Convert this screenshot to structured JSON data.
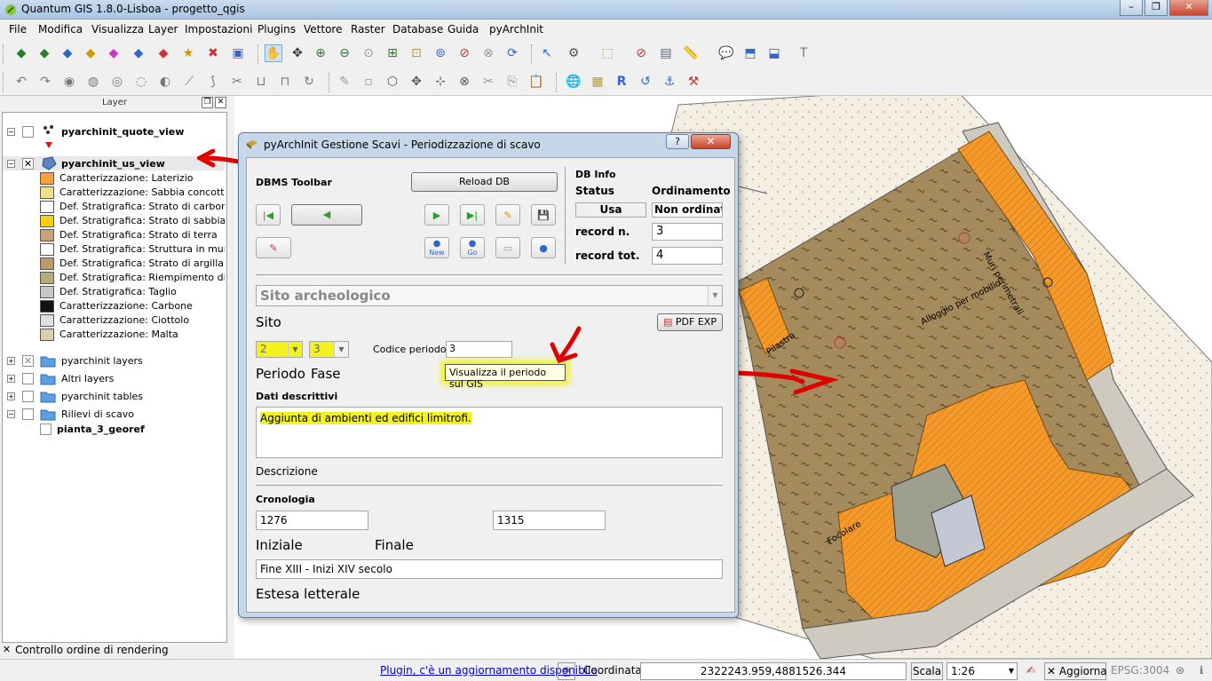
{
  "window": {
    "title": "Quantum GIS 1.8.0-Lisboa - progetto_qgis",
    "buttons": {
      "minimize": "–",
      "maximize": "❐",
      "close": "✕"
    }
  },
  "menu": [
    "File",
    "Modifica",
    "Visualizza",
    "Layer",
    "Impostazioni",
    "Plugins",
    "Vettore",
    "Raster",
    "Database",
    "Guida",
    "pyArchInit"
  ],
  "layers_panel": {
    "title": "Layer",
    "items": [
      {
        "label": "pyarchinit_quote_view",
        "bold": true,
        "checked": false,
        "expanded": true
      },
      {
        "label": "pyarchinit_us_view",
        "bold": true,
        "checked": true,
        "expanded": true
      },
      {
        "label": "Caratterizzazione: Laterizio",
        "color": "#f5a33a"
      },
      {
        "label": "Caratterizzazione: Sabbia concottata",
        "color": "#f5e08a"
      },
      {
        "label": "Def. Stratigrafica: Strato di carbone...",
        "color": "#ffffff"
      },
      {
        "label": "Def. Stratigrafica: Strato di sabbia c...",
        "color": "#f2d20f"
      },
      {
        "label": "Def. Stratigrafica: Strato di terra",
        "color": "#c9a27a"
      },
      {
        "label": "Def. Stratigrafica: Struttura in murat...",
        "color": "#ffffff"
      },
      {
        "label": "Def. Stratigrafica: Strato di argilla",
        "color": "#b89c6e"
      },
      {
        "label": "Def. Stratigrafica: Riempimento di ar...",
        "color": "#b7ad7a"
      },
      {
        "label": "Def. Stratigrafica: Taglio",
        "color": "#c8c8c8"
      },
      {
        "label": "Caratterizzazione: Carbone",
        "color": "#111111"
      },
      {
        "label": "Caratterizzazione: Ciottolo",
        "color": "#e0e0e0"
      },
      {
        "label": "Caratterizzazione: Malta",
        "color": "#d8d0b0"
      },
      {
        "label": "pyarchinit layers",
        "group": true
      },
      {
        "label": "Altri layers",
        "group": true
      },
      {
        "label": "pyarchinit tables",
        "group": true
      },
      {
        "label": "Rilievi di scavo",
        "group": true
      },
      {
        "label": "pianta_3_georef",
        "bold": true
      }
    ],
    "render_order_label": "Controllo ordine di rendering"
  },
  "dialog": {
    "title": "pyArchInit Gestione Scavi - Periodizzazione di scavo",
    "dbms_toolbar_label": "DBMS Toolbar",
    "reload_button": "Reload DB",
    "new_label": "New",
    "go_label": "Go",
    "db_info": {
      "title": "DB Info",
      "status_label": "Status",
      "status_value": "Usa",
      "order_label": "Ordinamento",
      "order_value": "Non ordinati",
      "record_n_label": "record n.",
      "record_n_value": "3",
      "record_tot_label": "record tot.",
      "record_tot_value": "4"
    },
    "sito_combo": "Sito archeologico",
    "sito_label": "Sito",
    "pdf_button": "PDF EXP",
    "periodo_value": "2",
    "fase_value": "3",
    "codice_label": "Codice periodo",
    "codice_value": "3",
    "periodo_label": "Periodo",
    "fase_label": "Fase",
    "tooltip": "Visualizza il periodo sul GIS",
    "dati_label": "Dati descrittivi",
    "description_text": "Aggiunta di ambienti ed edifici limitrofi.",
    "descrizione_label": "Descrizione",
    "cronologia_label": "Cronologia",
    "iniziale_value": "1276",
    "finale_value": "1315",
    "iniziale_label": "Iniziale",
    "finale_label": "Finale",
    "estesa_value": "Fine XIII - Inizi XIV secolo",
    "estesa_label": "Estesa letterale"
  },
  "map": {
    "labels": {
      "muri": "Muri perimetrali",
      "alloggio": "Alloggio per mobilio",
      "pilastro": "Pilastro",
      "focolare": "Focolare"
    },
    "colors": {
      "ground": "#a58a5c",
      "brick": "#f59a2a",
      "annotation": "#e00000"
    }
  },
  "statusbar": {
    "plugin_link": "Plugin, c'è un aggiornamento disponibile",
    "coord_label": "Coordinata:",
    "coord_value": "2322243.959,4881526.344",
    "scale_label": "Scala",
    "scale_value": "1:26",
    "refresh_label": "Aggiorna",
    "epsg": "EPSG:3004"
  }
}
